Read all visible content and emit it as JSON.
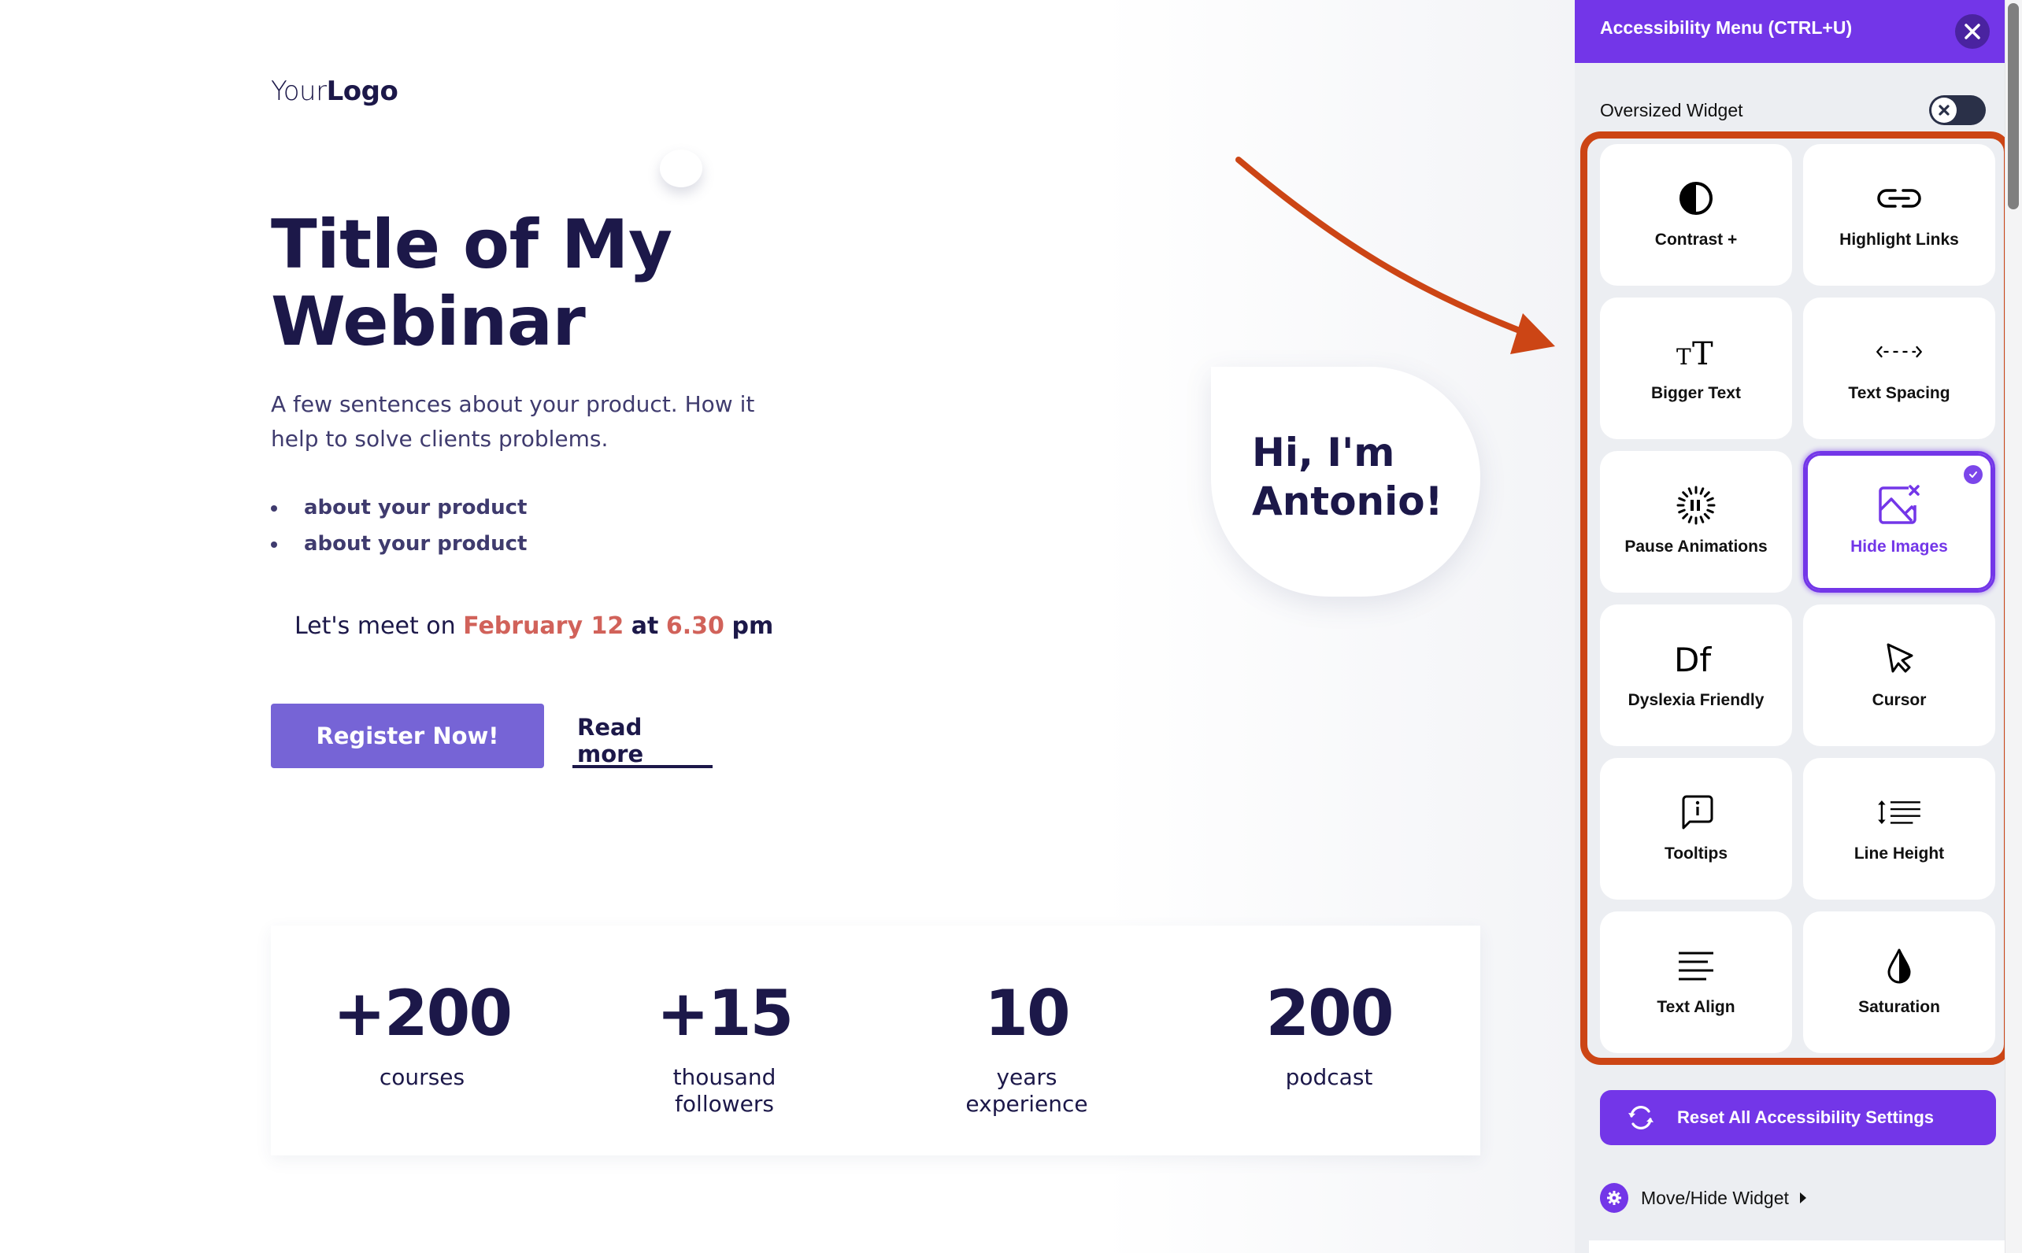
{
  "page": {
    "logo": {
      "light": "Your",
      "bold": "Logo"
    },
    "title": "Title of My Webinar",
    "description": "A few sentences about your product. How it help to solve clients problems.",
    "bullets": [
      "about your product",
      "about your product"
    ],
    "meet": {
      "prefix": "Let's meet on",
      "date": "February 12",
      "at": "at",
      "time": "6.30",
      "suffix": "pm"
    },
    "register_label": "Register Now!",
    "read_more_label": "Read more",
    "bubble_text": "Hi, I'm Antonio!",
    "stats": [
      {
        "value": "+200",
        "label": "courses"
      },
      {
        "value": "+15",
        "label": "thousand followers"
      },
      {
        "value": "10",
        "label": "years experience"
      },
      {
        "value": "200",
        "label": "podcast"
      }
    ]
  },
  "colors": {
    "brand_dark": "#1c1849",
    "accent_red": "#d1625a",
    "button_purple": "#7664d6",
    "widget_purple": "#7336e8",
    "annotation_red": "#cc4515"
  },
  "accessibility_menu": {
    "title": "Accessibility Menu (CTRL+U)",
    "close_icon": "close-icon",
    "oversized_widget": {
      "label": "Oversized Widget",
      "enabled": false
    },
    "tiles": [
      {
        "label": "Contrast +",
        "icon": "contrast-icon",
        "active": false
      },
      {
        "label": "Highlight Links",
        "icon": "link-icon",
        "active": false
      },
      {
        "label": "Bigger Text",
        "icon": "text-size-icon",
        "active": false
      },
      {
        "label": "Text Spacing",
        "icon": "text-spacing-icon",
        "active": false
      },
      {
        "label": "Pause Animations",
        "icon": "pause-animations-icon",
        "active": false
      },
      {
        "label": "Hide Images",
        "icon": "hide-images-icon",
        "active": true
      },
      {
        "label": "Dyslexia Friendly",
        "icon": "dyslexia-icon",
        "active": false
      },
      {
        "label": "Cursor",
        "icon": "cursor-icon",
        "active": false
      },
      {
        "label": "Tooltips",
        "icon": "tooltip-icon",
        "active": false
      },
      {
        "label": "Line Height",
        "icon": "line-height-icon",
        "active": false
      },
      {
        "label": "Text Align",
        "icon": "text-align-icon",
        "active": false
      },
      {
        "label": "Saturation",
        "icon": "saturation-icon",
        "active": false
      }
    ],
    "reset_label": "Reset All Accessibility Settings",
    "move_hide_label": "Move/Hide Widget"
  }
}
